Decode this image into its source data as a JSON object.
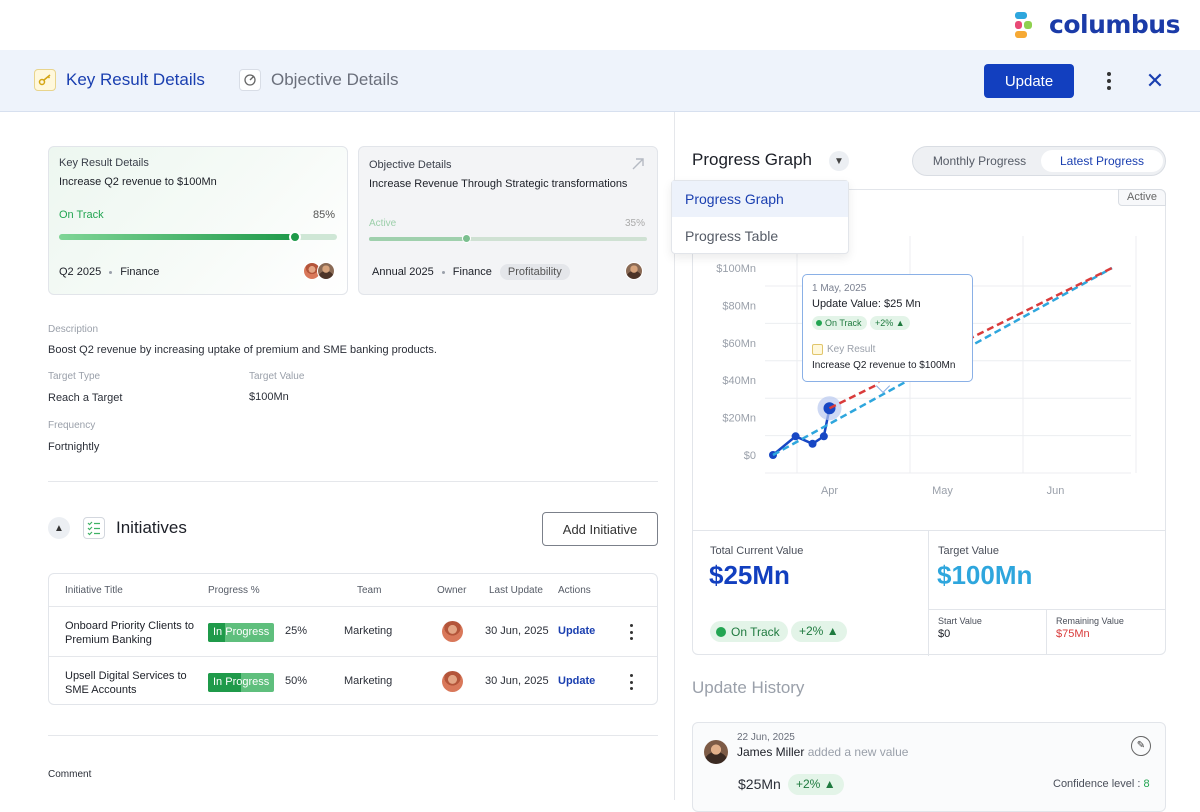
{
  "brand": {
    "name": "columbus"
  },
  "header": {
    "tabs": [
      {
        "label": "Key Result Details",
        "active": true
      },
      {
        "label": "Objective Details",
        "active": false
      }
    ],
    "update_label": "Update"
  },
  "kr_card": {
    "label": "Key Result Details",
    "title": "Increase Q2 revenue to $100Mn",
    "status": "On Track",
    "percent_label": "85%",
    "progress": 0.85,
    "period": "Q2 2025",
    "team": "Finance"
  },
  "obj_card": {
    "label": "Objective Details",
    "title": "Increase Revenue Through Strategic transformations",
    "status": "Active",
    "percent_label": "35%",
    "progress": 0.35,
    "period": "Annual 2025",
    "team": "Finance",
    "tag": "Profitability"
  },
  "details": {
    "description_label": "Description",
    "description": "Boost Q2 revenue by increasing uptake of premium and SME banking products.",
    "target_type_label": "Target Type",
    "target_type": "Reach a Target",
    "target_value_label": "Target Value",
    "target_value": "$100Mn",
    "frequency_label": "Frequency",
    "frequency": "Fortnightly"
  },
  "initiatives": {
    "title": "Initiatives",
    "add_label": "Add Initiative",
    "columns": [
      "Initiative Title",
      "Progress %",
      "Team",
      "Owner",
      "Last Update",
      "Actions"
    ],
    "rows": [
      {
        "title": "Onboard Priority Clients to Premium Banking",
        "status": "In Progress",
        "progress": 0.25,
        "percent": "25%",
        "team": "Marketing",
        "last_update": "30 Jun, 2025",
        "action": "Update"
      },
      {
        "title": "Upsell Digital Services to SME Accounts",
        "status": "In Progress",
        "progress": 0.5,
        "percent": "50%",
        "team": "Marketing",
        "last_update": "30 Jun, 2025",
        "action": "Update"
      }
    ]
  },
  "comment_label": "Comment",
  "graph": {
    "title": "Progress Graph",
    "segments": [
      "Monthly Progress",
      "Latest Progress"
    ],
    "active_segment": "Latest Progress",
    "active_tag": "Active",
    "dropdown": [
      "Progress Graph",
      "Progress Table"
    ],
    "dropdown_selected": "Progress Graph",
    "tooltip": {
      "date": "1 May, 2025",
      "update_value": "Update Value: $25 Mn",
      "status": "On Track",
      "change": "+2%",
      "kr_label": "Key Result",
      "kr_title": "Increase Q2 revenue to $100Mn"
    }
  },
  "chart_data": {
    "type": "line",
    "y_ticks": [
      "$0",
      "$20Mn",
      "$40Mn",
      "$60Mn",
      "$80Mn",
      "$100Mn"
    ],
    "x_ticks": [
      "Apr",
      "May",
      "Jun"
    ],
    "ylim": [
      0,
      100
    ],
    "series": [
      {
        "points": [
          [
            0,
            0
          ],
          [
            0.2,
            10
          ],
          [
            0.35,
            6
          ],
          [
            0.45,
            10
          ],
          [
            0.5,
            25
          ]
        ],
        "color": "#1747c4"
      },
      {
        "points": [
          [
            0,
            0
          ],
          [
            3,
            100
          ]
        ],
        "color": "#2ea6dd",
        "dashed": true
      },
      {
        "points": [
          [
            0.5,
            25
          ],
          [
            3,
            100
          ]
        ],
        "color": "#d93b3b",
        "dashed": true
      }
    ]
  },
  "stats": {
    "current_label": "Total Current Value",
    "current_value": "$25Mn",
    "target_label": "Target Value",
    "target_value": "$100Mn",
    "status": "On Track",
    "change": "+2%",
    "start_label": "Start Value",
    "start_value": "$0",
    "remaining_label": "Remaining Value",
    "remaining_value": "$75Mn"
  },
  "history": {
    "title": "Update History",
    "date": "22 Jun, 2025",
    "user": "James Miller",
    "action": "added a new value",
    "value": "$25Mn",
    "change": "+2%",
    "confidence_label": "Confidence level :",
    "confidence_value": "8"
  },
  "colors": {
    "primary": "#123fbf",
    "success": "#23a552",
    "accent": "#2ea6dd",
    "danger": "#d93b3b"
  }
}
